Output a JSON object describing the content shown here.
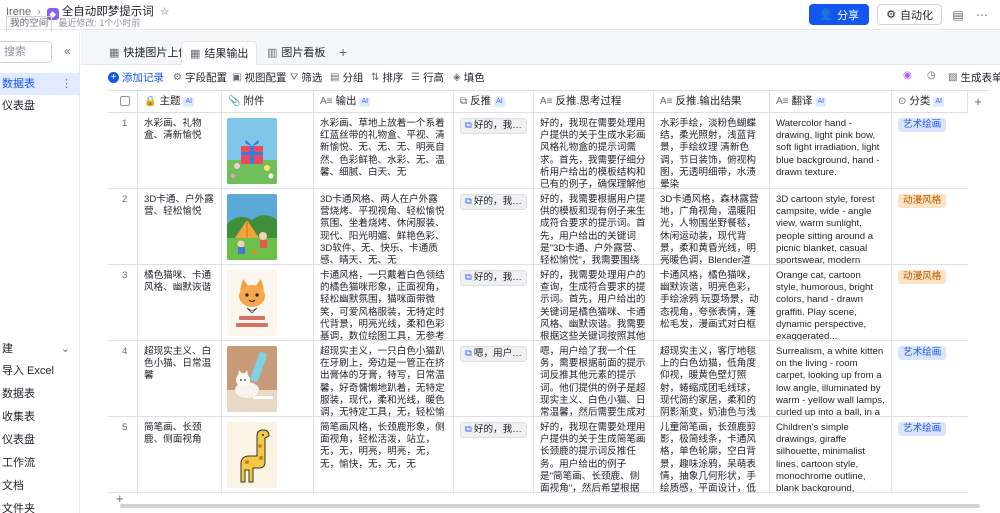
{
  "header": {
    "breadcrumb_root": "Irene",
    "doc_title": "全自动即梦提示词",
    "space_tag": "我的空间",
    "last_modified": "最近修改: 1个小时前",
    "share_label": "分享",
    "automation_label": "自动化"
  },
  "sidebar": {
    "search_placeholder": "搜索",
    "items": [
      {
        "label": "数据表"
      },
      {
        "label": "仪表盘"
      }
    ],
    "group_label": "建",
    "create_items": [
      {
        "label": "导入 Excel"
      },
      {
        "label": "数据表"
      },
      {
        "label": "收集表"
      },
      {
        "label": "仪表盘"
      },
      {
        "label": "工作流"
      },
      {
        "label": "文档"
      },
      {
        "label": "文件夹"
      }
    ]
  },
  "tabs": [
    {
      "label": "快捷图片上传"
    },
    {
      "label": "结果输出"
    },
    {
      "label": "图片看板"
    }
  ],
  "toolbar": {
    "add_record": "添加记录",
    "field_config": "字段配置",
    "view_config": "视图配置",
    "filter": "筛选",
    "group": "分组",
    "sort": "排序",
    "row_height": "行高",
    "fill_color": "填色",
    "generate_form": "生成表单"
  },
  "columns": [
    {
      "label": "主题",
      "ai": "AI"
    },
    {
      "label": "附件"
    },
    {
      "label": "输出",
      "ai": "AI"
    },
    {
      "label": "反推",
      "ai": "AI"
    },
    {
      "label": "反推.思考过程"
    },
    {
      "label": "反推.输出结果"
    },
    {
      "label": "翻译",
      "ai": "AI"
    },
    {
      "label": "分类",
      "ai": "AI"
    }
  ],
  "rows": [
    {
      "num": "1",
      "theme": "水彩画、礼物盒、清新愉悦",
      "output": "水彩画、草地上放着一个系着红蓝丝带的礼物盒、平视、清新愉悦、无、无、无、明亮自然、色彩鲜艳、水彩、无、温馨、细腻、白天、无",
      "reverse": "好的，我现...",
      "thinking": "好的，我现在需要处理用户提供的关于生成水彩画风格礼物盒的提示词需求。首先，我需要仔细分析用户给出的模板结构和已有的例子，确保理解他们的要求。用户...",
      "result": "水彩手绘，淡粉色蝴蝶结，柔光照射，浅蓝背景，手绘纹理 清新色调，节日装饰，俯视构图，无透明细带，水渍晕染",
      "translation": "Watercolor hand - drawing, light pink bow, soft light irradiation, light blue background, hand - drawn texture.",
      "category": "艺术绘画",
      "category_style": "art"
    },
    {
      "num": "2",
      "theme": "3D卡通、户外露营、轻松愉悦",
      "output": "3D卡通风格、两人在户外露营烧烤、平视视角、轻松愉悦氛围、坐着烧烤、休闲服装、现代、阳光明媚、鲜艳色彩、3D软件、无、快乐、卡通质感、晴天、无、无",
      "reverse": "好的，我需...",
      "thinking": "好的，我需要根据用户提供的模板和现有例子来生成符合要求的提示词。首先，用户给出的关键词是\"3D卡通、户外露营、轻松愉悦\"，我需要围绕这些核心元素展开...",
      "result": "3D卡通风格，森林露营地，广角视角，温暖阳光，人物围坐野餐毯，休闲运动装，现代背景，柔和黄昏光线，明亮暖色调，Blender渲染，皮克斯动画参考，欢乐氛...",
      "translation": "3D cartoon style, forest campsite, wide - angle view, warm sunlight, people sitting around a picnic blanket, casual sportswear, modern background, soft dusk light,...",
      "category": "动漫风格",
      "category_style": "anime"
    },
    {
      "num": "3",
      "theme": "橘色猫咪、卡通风格、幽默诙谐",
      "output": "卡通风格，一只戴着白色领结的橘色猫咪形象，正面视角，轻松幽默氛围，猫咪面带微笑，可爱风格服装，无特定时代背景，明亮光线，柔和色彩基调，数位绘图工具，无参考艺术家，幽默诙谐情感氛围，平滑质感...",
      "reverse": "好的，我需...",
      "thinking": "好的，我需要处理用户的查询，生成符合要求的提示词。首先，用户给出的关键词是橘色猫咪、卡通风格、幽默诙谐。我需要根据这些关键词按照其他元素的模板...",
      "result": "卡通风格，橘色猫咪，幽默诙谐，明亮色彩，手绘涂鸦 玩耍场景，动态视角，夸张表情，蓬松毛发，漫画式对白框",
      "translation": "Orange cat, cartoon style, humorous, bright colors, hand - drawn graffiti. Play scene, dynamic perspective, exaggerated...",
      "category": "动漫风格",
      "category_style": "anime"
    },
    {
      "num": "4",
      "theme": "超现实主义、白色小猫、日常温馨",
      "output": "超现实主义，一只白色小猫趴在牙刷上，旁边是一管正在挤出膏体的牙膏，特写，日常温馨，好奇慵懒地趴着，无特定服装，现代，柔和光线，暖色调，无特定工具，无，轻松愉悦，细腻质感，无特定天气/时间，无",
      "reverse": "嗯，用户给...",
      "thinking": "嗯，用户给了我一个任务，需要根据前面的提示词反推其他元素的提示词。他们提供的例子是超现实主义、白色小猫、日常温馨，然后需要生成对应的提示词。我需...",
      "result": "超现实主义，客厅地毯上的白色幼猫，低角度仰视，暖黄色壁灯照射，蜷缩成团毛线球，现代简约家居，柔和的阴影渐变，奶油色与浅灰色调，真实胶片相机拍摄，萨尔瓦多·...",
      "translation": "Surrealism, a white kitten on the living - room carpet, looking up from a low angle, illuminated by warm - yellow wall lamps, curled up into a ball, in a modern and...",
      "category": "艺术绘画",
      "category_style": "art"
    },
    {
      "num": "5",
      "theme": "简笔画、长颈鹿、侧面视角",
      "output": "简笔画风格，长颈鹿形象，侧面视角，轻松活泼，站立，无，无，明亮，明亮，无，无，愉快，无，无，无",
      "reverse": "好的，我现...",
      "thinking": "好的，我现在需要处理用户提供的关于生成简笔画长颈鹿的提示词反推任务。用户给出的例子是\"简笔画、长颈鹿、侧面视角\"，然后希望根据模板生成其他相关元素...",
      "result": "儿童简笔画，长颈鹿剪影，极简线条，卡通风格，单色轮廓，空白背景，趣味涂鸦，呆萌表情，抽象几何形状，手绘质感，平面设计，低多边形，黑白对比，失量...",
      "translation": "Children's simple drawings, giraffe silhouette, minimalist lines, cartoon style, monochrome outline, blank background, interesting graffiti, cute expressions,...",
      "category": "艺术绘画",
      "category_style": "art"
    }
  ]
}
